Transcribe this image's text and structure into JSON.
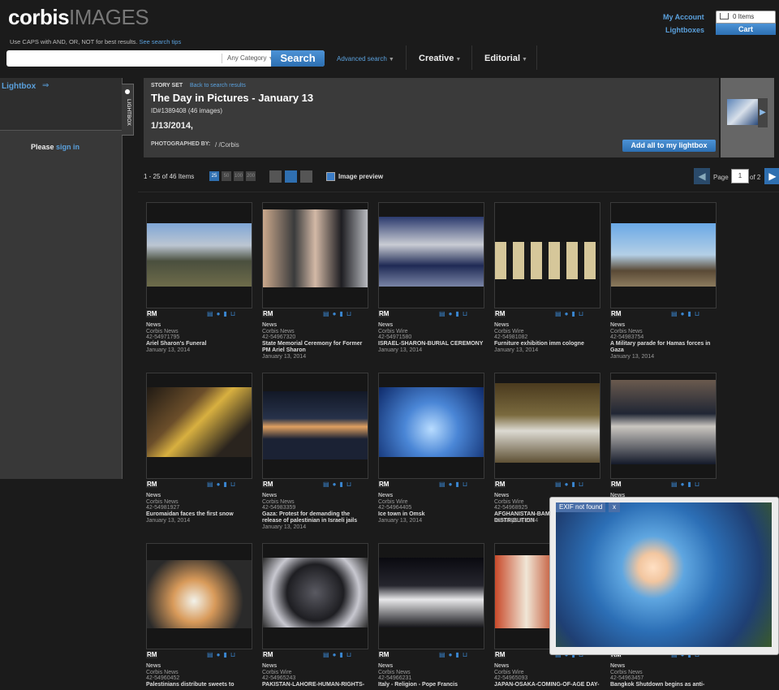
{
  "header": {
    "logo_brand": "corbis",
    "logo_suffix": "IMAGES",
    "caps_hint": "Use CAPS with AND, OR, NOT for best results.",
    "search_tips_label": "See search tips",
    "search_value": "",
    "category_label": "Any Category",
    "search_button": "Search",
    "advanced_search": "Advanced search",
    "nav_creative": "Creative",
    "nav_editorial": "Editorial",
    "my_account": "My Account",
    "lightboxes": "Lightboxes",
    "cart_items": "0 Items",
    "cart_button": "Cart"
  },
  "sidebar": {
    "title": "Lightbox",
    "please": "Please",
    "sign_in": "sign in",
    "tab_label": "LIGHTBOX"
  },
  "story": {
    "label": "STORY SET",
    "back_link": "Back to search results",
    "title": "The Day in Pictures - January 13",
    "id_line": "ID#1389408 (46 images)",
    "date": "1/13/2014,",
    "photographed_by_label": "PHOTOGRAPHED BY:",
    "photographed_by_value": "/ /Corbis",
    "add_all_button": "Add all to my lightbox"
  },
  "results": {
    "count": "1 - 25 of 46 Items",
    "per_page": [
      "25",
      "50",
      "100",
      "200"
    ],
    "image_preview_label": "Image preview",
    "page_label": "Page",
    "page_value": "1",
    "page_of": "of 2"
  },
  "accent_color": "#3a86d0",
  "items": [
    {
      "rm": "RM",
      "category": "News",
      "source": "Corbis News",
      "id": "42-54971795",
      "caption": "Ariel Sharon's Funeral",
      "date": "January 13, 2014"
    },
    {
      "rm": "RM",
      "category": "News",
      "source": "Corbis News",
      "id": "42-54967320",
      "caption": "State Memorial Ceremony for Former PM Ariel Sharon",
      "date": "January 13, 2014"
    },
    {
      "rm": "RM",
      "category": "News",
      "source": "Corbis Wire",
      "id": "42-54971580",
      "caption": "ISRAEL-SHARON-BURIAL CEREMONY",
      "date": "January 13, 2014"
    },
    {
      "rm": "RM",
      "category": "News",
      "source": "Corbis Wire",
      "id": "42-54981082",
      "caption": "Furniture exhibition imm cologne",
      "date": "January 13, 2014"
    },
    {
      "rm": "RM",
      "category": "News",
      "source": "Corbis News",
      "id": "42-54983754",
      "caption": "A Military parade for Hamas forces in Gaza",
      "date": "January 13, 2014"
    },
    {
      "rm": "RM",
      "category": "News",
      "source": "Corbis News",
      "id": "42-54981927",
      "caption": "Euromaidan faces the first snow",
      "date": "January 13, 2014"
    },
    {
      "rm": "RM",
      "category": "News",
      "source": "Corbis News",
      "id": "42-54983359",
      "caption": "Gaza: Protest for demanding the release of palestinian in Israeli jails",
      "date": "January 13, 2014"
    },
    {
      "rm": "RM",
      "category": "News",
      "source": "Corbis Wire",
      "id": "42-54964405",
      "caption": "Ice town in Omsk",
      "date": "January 13, 2014"
    },
    {
      "rm": "RM",
      "category": "News",
      "source": "Corbis Wire",
      "id": "42-54968925",
      "caption": "AFGHANISTAN-BAMIYAN-DISTRIBUTION",
      "date": "January 13, 2014"
    },
    {
      "rm": "RM",
      "category": "News",
      "source": "",
      "id": "",
      "caption": "",
      "date": ""
    },
    {
      "rm": "RM",
      "category": "News",
      "source": "Corbis News",
      "id": "42-54960452",
      "caption": "Palestinians distribute sweets to",
      "date": ""
    },
    {
      "rm": "RM",
      "category": "News",
      "source": "Corbis Wire",
      "id": "42-54965243",
      "caption": "PAKISTAN-LAHORE-HUMAN-RIGHTS-",
      "date": ""
    },
    {
      "rm": "RM",
      "category": "News",
      "source": "Corbis News",
      "id": "42-54966231",
      "caption": "Italy - Religion - Pope Francis",
      "date": ""
    },
    {
      "rm": "RM",
      "category": "News",
      "source": "Corbis Wire",
      "id": "42-54965093",
      "caption": "JAPAN-OSAKA-COMING-OF-AGE DAY-",
      "date": ""
    },
    {
      "rm": "RM",
      "category": "News",
      "source": "Corbis News",
      "id": "42-54963457",
      "caption": "Bangkok Shutdown begins as anti-",
      "date": ""
    }
  ],
  "exif_popup": {
    "label": "EXIF not found",
    "close": "x"
  }
}
